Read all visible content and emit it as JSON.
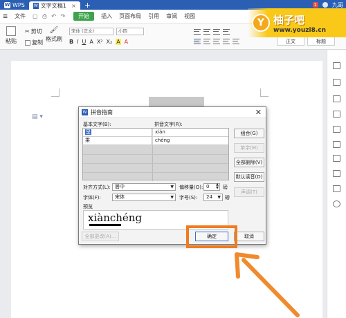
{
  "titlebar": {
    "app_name": "WPS",
    "doc_tab": "文字文稿1",
    "badge": "1",
    "user": "九哥"
  },
  "menubar": {
    "items": [
      "文件",
      "开始",
      "插入",
      "页面布局",
      "引用",
      "审阅",
      "视图"
    ]
  },
  "ribbon": {
    "paste": "粘贴",
    "cut": "剪切",
    "copy": "复制",
    "format_painter": "格式刷",
    "font_name": "宋体 (正文)",
    "font_size": "小四",
    "style_normal": "正文",
    "style_heading": "标题"
  },
  "watermark": {
    "letter": "Y",
    "title": "柚子吧",
    "url": "www.youzi8.cn"
  },
  "dialog": {
    "title": "拼音指南",
    "base_label": "基本文字(B):",
    "pinyin_label": "拼音文字(R):",
    "rows": [
      {
        "base": "呈",
        "pinyin": "xián"
      },
      {
        "base": "乘",
        "pinyin": "chéng"
      }
    ],
    "btn_group": "组合(G)",
    "btn_single": "单字(M)",
    "btn_clear_all": "全部删除(V)",
    "btn_default": "默认读音(D)",
    "btn_more": "声调(T)",
    "align_label": "对齐方式(L):",
    "align_value": "居中",
    "offset_label": "偏移量(O):",
    "offset_value": "0",
    "offset_unit": "磅",
    "font_label": "字体(F):",
    "font_value": "宋体",
    "size_label": "字号(S):",
    "size_value": "24",
    "size_unit": "磅",
    "preview_label": "预览",
    "preview_text": "xiànchéng",
    "btn_apply_all": "全部更改(A)...",
    "btn_ok": "确定",
    "btn_cancel": "取消"
  }
}
